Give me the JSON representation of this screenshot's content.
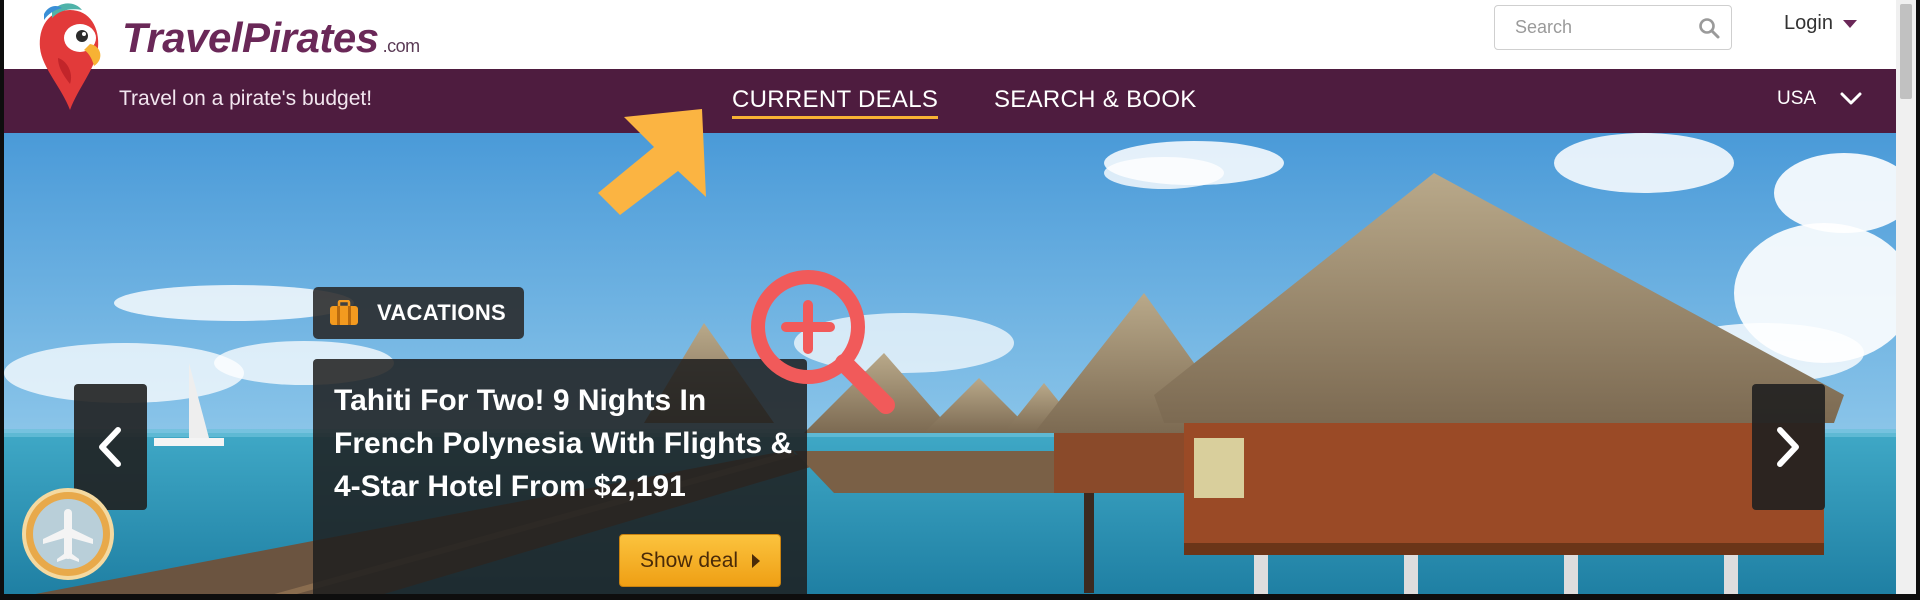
{
  "header": {
    "brand_name": "TravelPirates",
    "brand_suffix": ".com",
    "search": {
      "placeholder": "Search"
    },
    "login_label": "Login"
  },
  "nav": {
    "tagline": "Travel on a pirate's budget!",
    "links": [
      {
        "label": "CURRENT DEALS",
        "active": true
      },
      {
        "label": "SEARCH & BOOK",
        "active": false
      }
    ],
    "country": "USA"
  },
  "hero": {
    "category_label": "VACATIONS",
    "deal_title": "Tahiti For Two! 9 Nights In French Polynesia With Flights & 4-Star Hotel From $2,191",
    "show_deal_label": "Show deal"
  },
  "colors": {
    "brand_purple": "#4e1c3f",
    "accent_orange": "#f7b234",
    "annotation_red": "#f15a5a",
    "annotation_arrow": "#fbb442"
  },
  "icons": [
    "parrot-logo-icon",
    "search-icon",
    "caret-down-icon",
    "chevron-down-icon",
    "suitcase-icon",
    "chevron-left-icon",
    "chevron-right-icon",
    "plane-icon",
    "zoom-in-icon",
    "pointer-arrow-icon"
  ]
}
